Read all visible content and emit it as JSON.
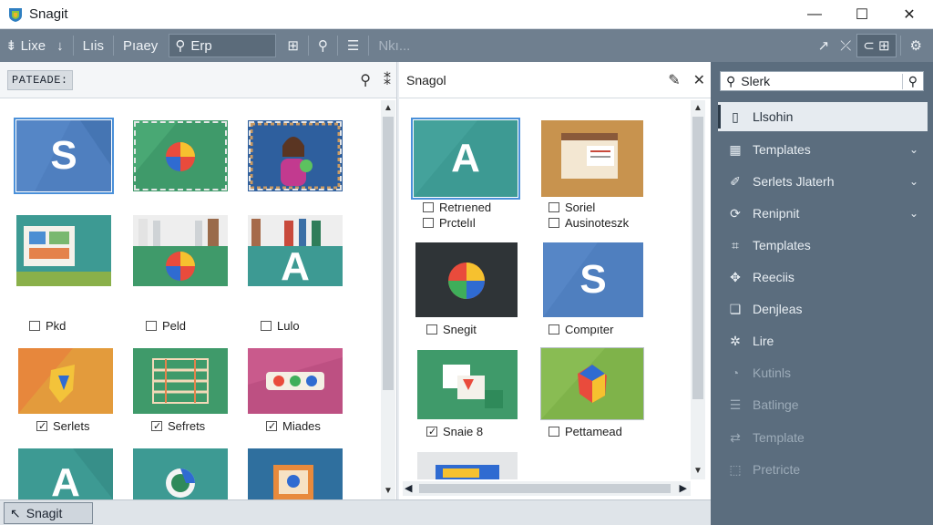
{
  "window": {
    "title": "Snagit",
    "minimize": "—",
    "maximize": "☐",
    "close": "✕"
  },
  "toolbar": {
    "item1": "Lixe",
    "item2": "Lıis",
    "item3": "Pıaey",
    "search_text": "Erp",
    "item_muted": "Nkı..."
  },
  "left_panel": {
    "chip": "PATEADE:",
    "rows": [
      [
        {
          "letter": "S",
          "caption": ""
        },
        {
          "letter": "",
          "caption": ""
        },
        {
          "letter": "",
          "caption": ""
        }
      ],
      [
        {
          "letter": "",
          "caption": "Pkd"
        },
        {
          "letter": "",
          "caption": "Peld"
        },
        {
          "letter": "A",
          "caption": "Lulo"
        }
      ],
      [
        {
          "letter": "",
          "caption": "Serlets"
        },
        {
          "letter": "",
          "caption": "Sefrets"
        },
        {
          "letter": "",
          "caption": "Miades"
        }
      ],
      [
        {
          "letter": "A",
          "caption": ""
        },
        {
          "letter": "",
          "caption": ""
        },
        {
          "letter": "",
          "caption": ""
        }
      ]
    ]
  },
  "mid_panel": {
    "title": "Snagol",
    "items": [
      {
        "letter": "A",
        "captions": [
          "Retrıened",
          "Prctelıl"
        ]
      },
      {
        "letter": "",
        "captions": [
          "Soriel",
          "Ausinoteszk"
        ]
      },
      {
        "letter": "",
        "captions": [
          "Snegit"
        ]
      },
      {
        "letter": "S",
        "captions": [
          "Compıter"
        ]
      },
      {
        "letter": "",
        "captions": [
          "Snaie 8"
        ]
      },
      {
        "letter": "",
        "captions": [
          "Pettamead"
        ]
      }
    ]
  },
  "sidebar": {
    "search_text": "Slerk",
    "items": [
      {
        "label": "Llsohin",
        "icon": "bookmark-icon",
        "chevron": false,
        "active": true,
        "dim": false
      },
      {
        "label": "Templates",
        "icon": "grid-icon",
        "chevron": true,
        "active": false,
        "dim": false
      },
      {
        "label": "Serlets Jlaterh",
        "icon": "brush-icon",
        "chevron": true,
        "active": false,
        "dim": false
      },
      {
        "label": "Renipnit",
        "icon": "paint-icon",
        "chevron": true,
        "active": false,
        "dim": false
      },
      {
        "label": "Templates",
        "icon": "crop-icon",
        "chevron": false,
        "active": false,
        "dim": false
      },
      {
        "label": "Reeciis",
        "icon": "puzzle-icon",
        "chevron": false,
        "active": false,
        "dim": false
      },
      {
        "label": "Denjleas",
        "icon": "layers-icon",
        "chevron": false,
        "active": false,
        "dim": false
      },
      {
        "label": "Lire",
        "icon": "gear-icon",
        "chevron": false,
        "active": false,
        "dim": false
      },
      {
        "label": "Kutinls",
        "icon": "pie-icon",
        "chevron": false,
        "active": false,
        "dim": true
      },
      {
        "label": "Batlinge",
        "icon": "sliders-icon",
        "chevron": false,
        "active": false,
        "dim": true
      },
      {
        "label": "Template",
        "icon": "arrows-icon",
        "chevron": false,
        "active": false,
        "dim": true
      },
      {
        "label": "Pretricte",
        "icon": "frame-icon",
        "chevron": false,
        "active": false,
        "dim": true
      }
    ]
  },
  "status": {
    "tab_label": "Snagit"
  },
  "colors": {
    "toolbar": "#6f7f8f",
    "sidebar": "#5b6d7e",
    "accent": "#4a90d9"
  }
}
